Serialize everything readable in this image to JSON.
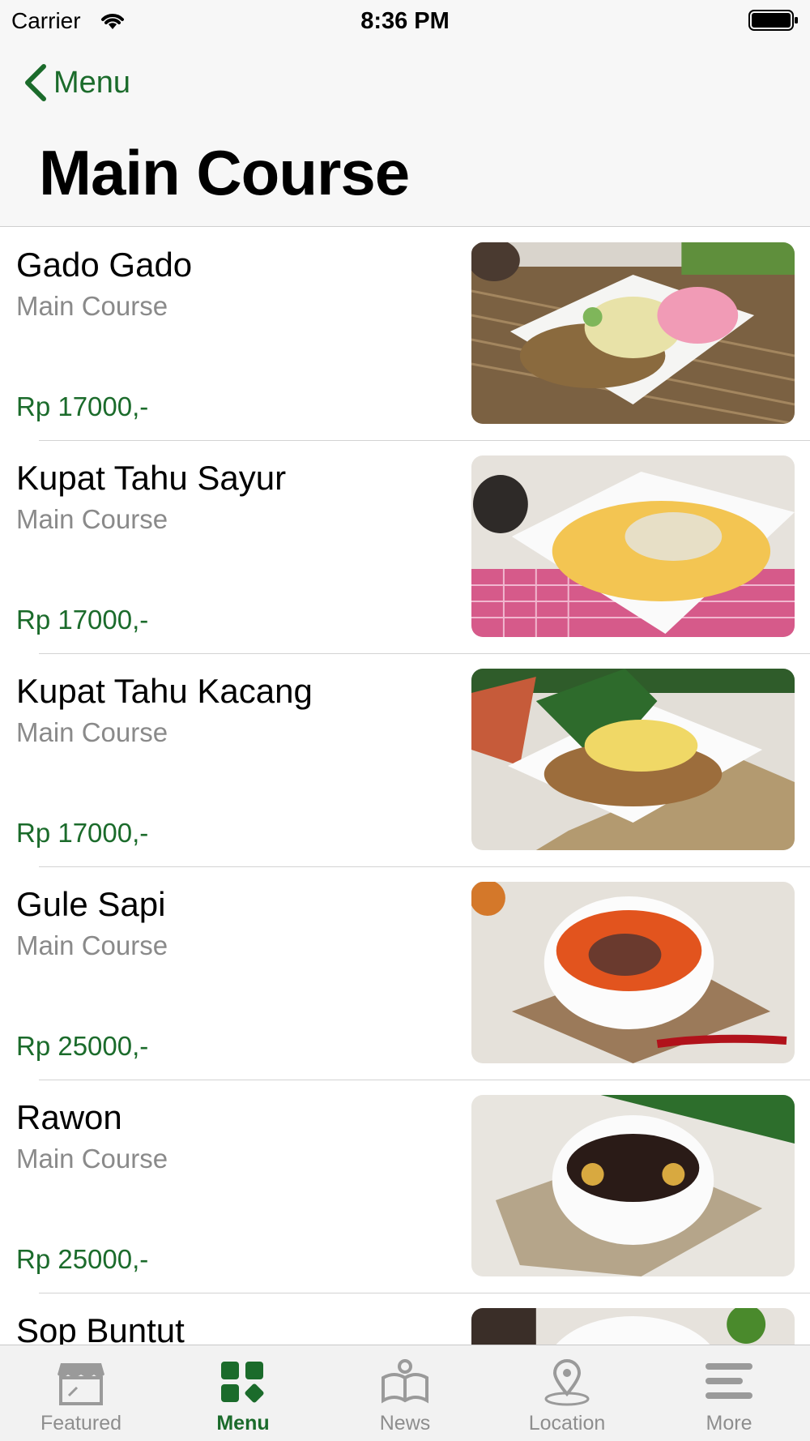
{
  "status_bar": {
    "carrier": "Carrier",
    "time": "8:36 PM"
  },
  "nav": {
    "back_label": "Menu",
    "title": "Main Course"
  },
  "colors": {
    "accent": "#1b6b2b",
    "secondary_text": "#8a8a8a"
  },
  "items": [
    {
      "name": "Gado Gado",
      "category": "Main Course",
      "price": "Rp 17000,-",
      "image": "gado-gado-photo"
    },
    {
      "name": "Kupat Tahu Sayur",
      "category": "Main Course",
      "price": "Rp 17000,-",
      "image": "kupat-tahu-sayur-photo"
    },
    {
      "name": "Kupat Tahu Kacang",
      "category": "Main Course",
      "price": "Rp 17000,-",
      "image": "kupat-tahu-kacang-photo"
    },
    {
      "name": "Gule Sapi",
      "category": "Main Course",
      "price": "Rp 25000,-",
      "image": "gule-sapi-photo"
    },
    {
      "name": "Rawon",
      "category": "Main Course",
      "price": "Rp 25000,-",
      "image": "rawon-photo"
    },
    {
      "name": "Sop Buntut",
      "category": "",
      "price": "",
      "image": "sop-buntut-photo"
    }
  ],
  "tabs": [
    {
      "label": "Featured",
      "icon": "storefront-icon",
      "active": false
    },
    {
      "label": "Menu",
      "icon": "menu-grid-icon",
      "active": true
    },
    {
      "label": "News",
      "icon": "news-icon",
      "active": false
    },
    {
      "label": "Location",
      "icon": "location-pin-icon",
      "active": false
    },
    {
      "label": "More",
      "icon": "more-lines-icon",
      "active": false
    }
  ]
}
